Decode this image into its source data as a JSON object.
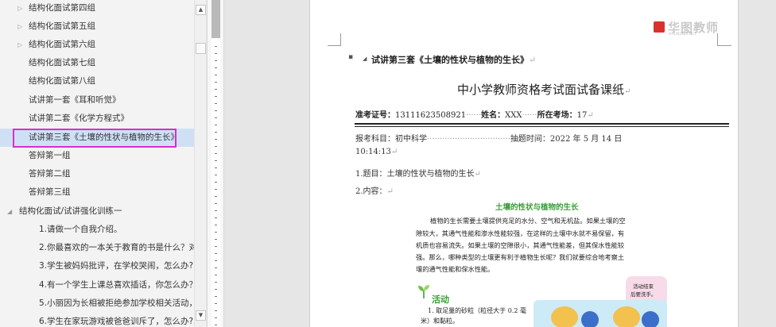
{
  "nav": {
    "items": [
      {
        "label": "结构化面试第四组",
        "arrow": "▷"
      },
      {
        "label": "结构化面试第五组",
        "arrow": "▷"
      },
      {
        "label": "结构化面试第六组",
        "arrow": "▷"
      },
      {
        "label": "结构化面试第七组",
        "arrow": ""
      },
      {
        "label": "结构化面试第八组",
        "arrow": ""
      },
      {
        "label": "试讲第一套《耳和听觉》",
        "arrow": ""
      },
      {
        "label": "试讲第二套《化学方程式》",
        "arrow": ""
      },
      {
        "label": "试讲第三套《土壤的性状与植物的生长》",
        "arrow": ""
      },
      {
        "label": "答辩第一组",
        "arrow": ""
      },
      {
        "label": "答辩第二组",
        "arrow": ""
      },
      {
        "label": "答辩第三组",
        "arrow": ""
      },
      {
        "label": "结构化面试/试讲强化训练一",
        "arrow": "◢"
      },
      {
        "label": "1.请做一个自我介绍。",
        "arrow": ""
      },
      {
        "label": "2.你最喜欢的一本关于教育的书是什么？对...",
        "arrow": ""
      },
      {
        "label": "3.学生被妈妈批评，在学校哭闹，怎么办?",
        "arrow": ""
      },
      {
        "label": "4.有一个学生上课总喜欢插话，你怎么办？",
        "arrow": ""
      },
      {
        "label": "5.小丽因为长相被拒绝参加学校相关活动，...",
        "arrow": ""
      },
      {
        "label": "6.学生在家玩游戏被爸爸训斥了，怎么办?",
        "arrow": ""
      }
    ],
    "scroll_up": "▲",
    "scroll_down": "▼"
  },
  "doc": {
    "logo_text": "华图教师",
    "logo_sub": "HTEACHER.NET",
    "bullet": "▪",
    "collapse": "◢",
    "heading": "试讲第三套《土壤的性状与植物的生长》",
    "para_mark": "↵",
    "title": "中小学教师资格考试面试备课纸",
    "exam_no_label": "准考证号：",
    "exam_no": "13111623508921",
    "dots1": "······",
    "name_label": "姓名：",
    "name": "XXX",
    "dots2": "······",
    "room_label": "所在考场：",
    "room": "17",
    "subject_label": "报考科目：",
    "subject": "初中科学",
    "subject_dots": "·································",
    "draw_time_label": "抽题时间：",
    "draw_time": "2022 年 5 月 14 日",
    "time": "10:14:13",
    "item1": "1.题目：土壤的性状与植物的生长",
    "item2": "2.内容：",
    "img_title": "土壤的性状与植物的生长",
    "img_lines": [
      "植物的生长需要土壤提供充足的水分、空气和无机盐。如果土壤的空",
      "隙较大，其通气性能和渗水性能较强，在这样的土壤中水就不易保留，有",
      "机质也容易流失。如果土壤的空隙很小，其通气性能差，但其保水性能较",
      "强。那么，哪种类型的土壤更有利于植物生长呢？我们就要综合地考察土",
      "壤的通气性能和保水性能。"
    ],
    "activity": "活动",
    "activity_note_1": "活动结束",
    "activity_note_2": "后要洗手。",
    "step1_a": "1. 取足量的砂粒（粒径大于 0.2 毫",
    "step1_b": "米）和黏粒。"
  }
}
